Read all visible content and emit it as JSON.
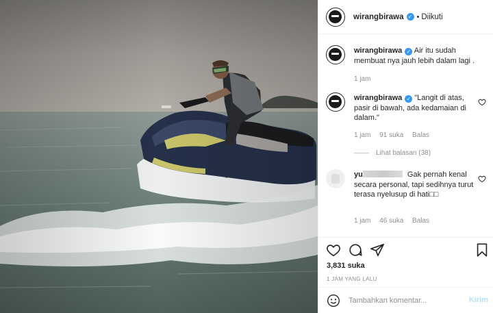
{
  "post": {
    "image_alt": "Man riding a jet ski on the sea",
    "colors": {
      "verified": "#3897f0",
      "muted": "#8e8e8e",
      "send_disabled": "#b2dffc"
    }
  },
  "header": {
    "username": "wirangbirawa",
    "follow_status": "Diikuti"
  },
  "comments": [
    {
      "username": "wirangbirawa",
      "text": "Air itu sudah membuat nya jauh lebih dalam lagi .",
      "time": "1 jam"
    },
    {
      "username": "wirangbirawa",
      "text": "\"Langit di atas, pasir di bawah, ada kedamaian di dalam.\"",
      "time": "1 jam",
      "likes": "91 suka",
      "reply": "Balas",
      "view_replies": "Lihat balasan (38)"
    },
    {
      "username": "yu",
      "text": "Gak pernah kenal secara personal, tapi sedihnya turut terasa nyelusup di hati",
      "time": "1 jam",
      "likes": "46 suka",
      "reply": "Balas"
    }
  ],
  "actions": {
    "like_icon": "heart-icon",
    "comment_icon": "comment-icon",
    "share_icon": "paper-plane-icon",
    "save_icon": "bookmark-icon",
    "likes_count": "3,831 suka",
    "posted_time": "1 JAM YANG LALU"
  },
  "add_comment": {
    "emoji_icon": "smiley-icon",
    "placeholder": "Tambahkan komentar...",
    "send_label": "Kirim"
  }
}
